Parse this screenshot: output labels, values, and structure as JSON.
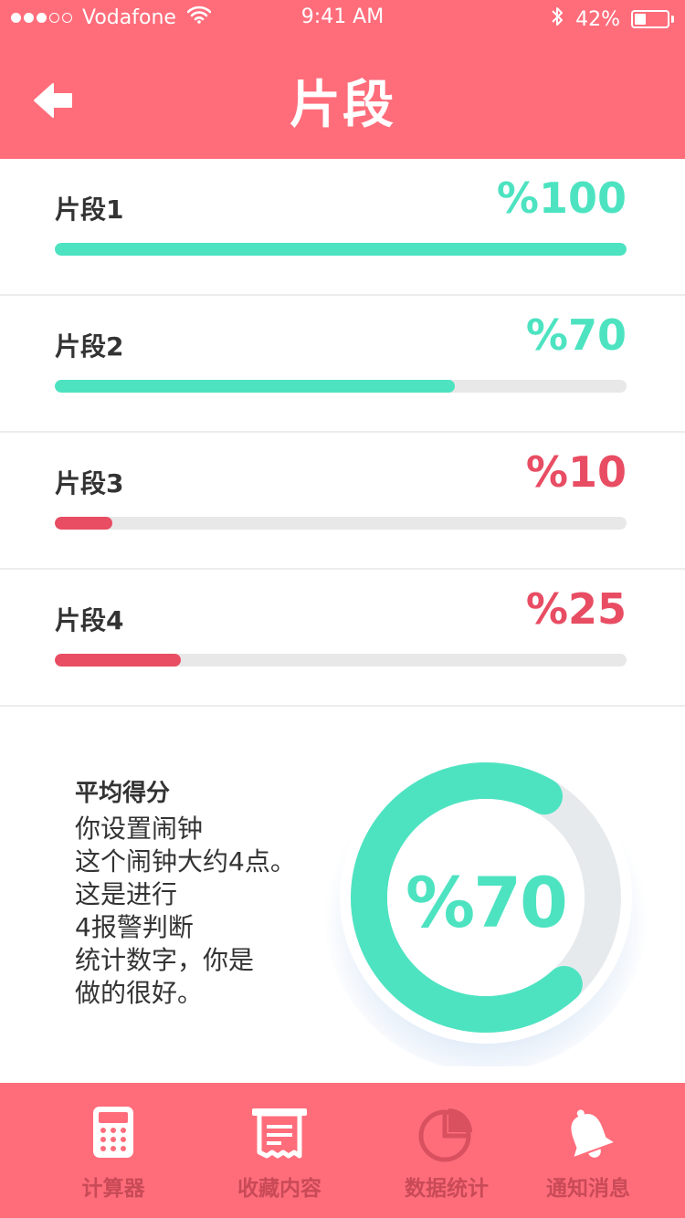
{
  "status_bar": {
    "carrier": "Vodafone",
    "time": "9:41 AM",
    "battery": "42%",
    "battery_level": 0.42,
    "signal_bars_filled": 3,
    "signal_bars_total": 5
  },
  "header": {
    "title": "片段",
    "back_icon": "arrow-left-icon"
  },
  "segments": [
    {
      "label": "片段1",
      "value": "%100",
      "level": 1.0,
      "color": "#4de3c1"
    },
    {
      "label": "片段2",
      "value": "%70",
      "level": 0.7,
      "color": "#4de3c1"
    },
    {
      "label": "片段3",
      "value": "%10",
      "level": 0.1,
      "color": "#e84d63"
    },
    {
      "label": "片段4",
      "value": "%25",
      "level": 0.22,
      "color": "#e84d63"
    }
  ],
  "summary": {
    "title": "平均得分",
    "lines": [
      "你设置闹钟",
      "这个闹钟大约4点。",
      "这是进行",
      "4报警判断",
      "统计数字，你是",
      "做的很好。"
    ],
    "gauge_value": "%70",
    "gauge_level": 0.7
  },
  "tabs": [
    {
      "label": "计算器",
      "icon": "calculator-icon"
    },
    {
      "label": "收藏内容",
      "icon": "receipt-icon"
    },
    {
      "label": "数据统计",
      "icon": "pie-chart-icon"
    },
    {
      "label": "通知消息",
      "icon": "bell-icon"
    }
  ],
  "colors": {
    "primary": "#ff6d7b",
    "accent_green": "#4de3c1",
    "accent_red": "#e84d63",
    "track": "#e8e8e8",
    "text_dark": "#333333",
    "tab_label": "#c94a57"
  }
}
